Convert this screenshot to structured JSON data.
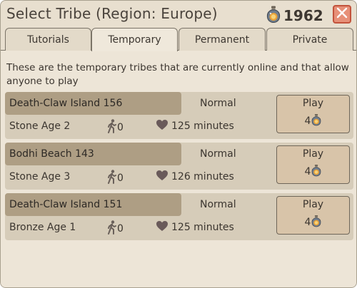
{
  "dialog": {
    "title": "Select Tribe (Region: Europe)",
    "currency_amount": "1962",
    "close_icon": "close-x-icon",
    "accent_close": "#e79078"
  },
  "tabs": [
    {
      "label": "Tutorials",
      "active": false
    },
    {
      "label": "Temporary",
      "active": true
    },
    {
      "label": "Permanent",
      "active": false
    },
    {
      "label": "Private",
      "active": false
    }
  ],
  "intro": "These are the temporary tribes that are currently online and that allow anyone to play",
  "play_label": "Play",
  "tribes": [
    {
      "name": "Death-Claw Island 156",
      "mode": "Normal",
      "age": "Stone Age 2",
      "players": "0",
      "duration": "125 minutes",
      "cost": "4"
    },
    {
      "name": "Bodhi Beach 143",
      "mode": "Normal",
      "age": "Stone Age 3",
      "players": "0",
      "duration": "126 minutes",
      "cost": "4"
    },
    {
      "name": "Death-Claw Island 151",
      "mode": "Normal",
      "age": "Bronze Age 1",
      "players": "0",
      "duration": "125 minutes",
      "cost": "4"
    }
  ],
  "icons": {
    "currency": "potion-bottle-icon",
    "players": "walking-person-icon",
    "duration": "heart-icon"
  }
}
